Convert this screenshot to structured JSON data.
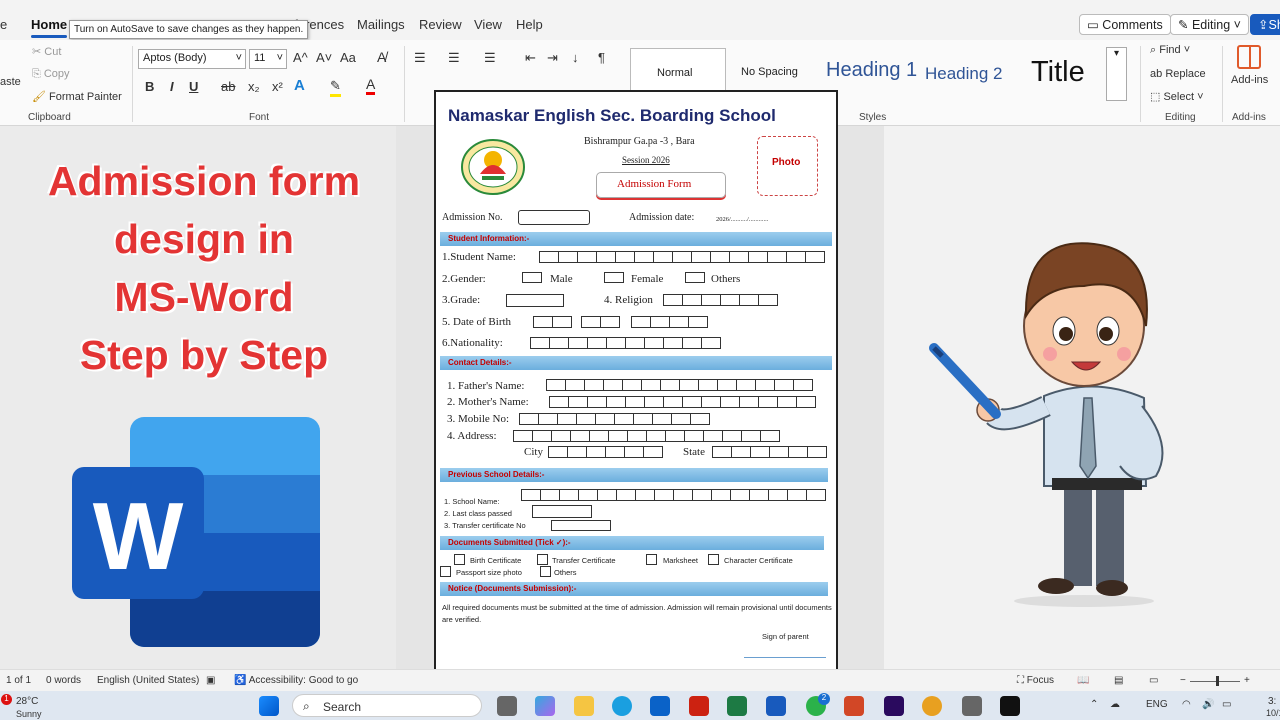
{
  "tabs": {
    "partial_left": "e",
    "home": "Home",
    "references": "eferences",
    "mailings": "Mailings",
    "review": "Review",
    "view": "View",
    "help": "Help"
  },
  "tooltip": "Turn on AutoSave to save changes as they happen.",
  "top_buttons": {
    "comments": "Comments",
    "editing": "Editing",
    "share": "Sh"
  },
  "clipboard": {
    "paste": "aste",
    "cut": "Cut",
    "copy": "Copy",
    "format_painter": "Format Painter",
    "label": "Clipboard"
  },
  "font": {
    "name": "Aptos (Body)",
    "size": "11",
    "label": "Font",
    "grow": "A^",
    "shrink": "A˅",
    "case": "Aa",
    "bold": "B",
    "italic": "I",
    "underline": "U",
    "strike": "ab",
    "sub": "x₂",
    "sup": "x²"
  },
  "paragraph": {
    "pilcrow": "¶"
  },
  "styles": {
    "normal": "Normal",
    "no_spacing": "No Spacing",
    "heading1": "Heading 1",
    "heading2": "Heading 2",
    "title": "Title",
    "label": "Styles"
  },
  "editing_group": {
    "find": "Find",
    "replace": "Replace",
    "select": "Select",
    "label": "Editing"
  },
  "addins": {
    "label": "Add-ins",
    "group": "Add-ins"
  },
  "left_title": [
    "Admission form",
    "design in",
    "MS-Word",
    "Step by Step"
  ],
  "form": {
    "school": "Namaskar English Sec. Boarding School",
    "address": "Bishrampur Ga.pa -3 , Bara",
    "session": "Session 2026",
    "form_title": "Admission Form",
    "photo": "Photo",
    "adm_no": "Admission No.",
    "adm_date": "Admission date:",
    "adm_date_value": "2026/........../............",
    "sec_student": "Student Information:-",
    "student_name": "1.Student Name:",
    "gender": "2.Gender:",
    "male": "Male",
    "female": "Female",
    "others": "Others",
    "grade": "3.Grade:",
    "religion": "4. Religion",
    "dob": "5. Date of Birth",
    "nationality": "6.Nationality:",
    "sec_contact": "Contact Details:-",
    "father": "1. Father's Name:",
    "mother": "2. Mother's Name:",
    "mobile": "3. Mobile No:",
    "address_label": "4. Address:",
    "city": "City",
    "state": "State",
    "sec_prev": "Previous School Details:-",
    "school_name": "1.   School Name:",
    "last_class": "2.   Last class passed",
    "transfer": "3.   Transfer certificate No",
    "sec_docs": "Documents Submitted (Tick ✓):-",
    "doc_birth": "Birth Certificate",
    "doc_transfer": "Transfer Certificate",
    "doc_marksheet": "Marksheet",
    "doc_character": "Character Certificate",
    "doc_passport": "Passport size photo",
    "doc_others": "Others",
    "sec_notice": "Notice (Documents Submission):-",
    "notice_text": "All required documents must be submitted at the time of admission. Admission will remain provisional until documents are verified.",
    "sign": "Sign of parent"
  },
  "status": {
    "page": "1 of 1",
    "words": "0 words",
    "language": "English (United States)",
    "accessibility": "Accessibility: Good to go",
    "focus": "Focus"
  },
  "taskbar": {
    "temp": "28°C",
    "weather": "Sunny",
    "search": "Search",
    "lang": "ENG",
    "time": "3:",
    "date": "10/1",
    "badge": "1",
    "whatsapp_badge": "2"
  },
  "colors": {
    "accent": "#185abd",
    "title_red": "#e33434",
    "band": "#6baedd"
  }
}
